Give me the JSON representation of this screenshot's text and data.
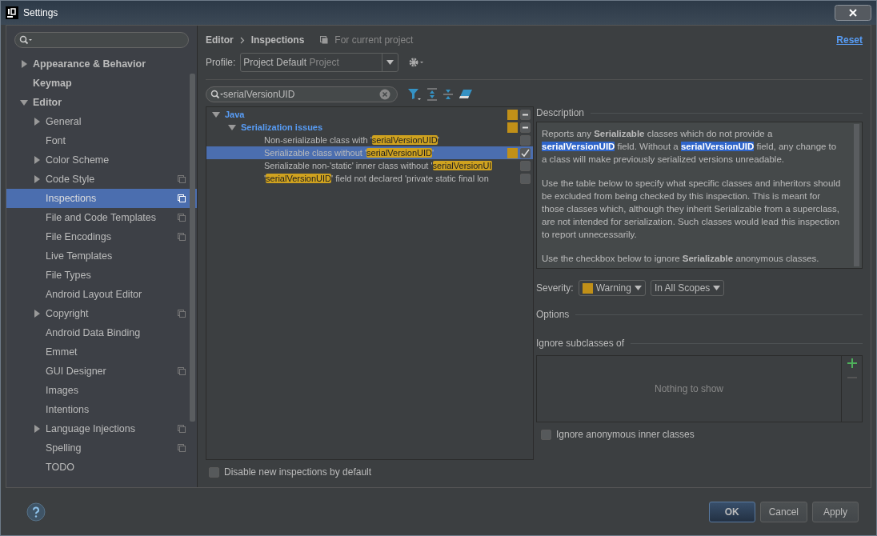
{
  "window": {
    "title": "Settings"
  },
  "sidebar": {
    "items": [
      {
        "label": "Appearance & Behavior",
        "expanded": false,
        "project_scope": false
      },
      {
        "label": "Keymap",
        "project_scope": false
      },
      {
        "label": "Editor",
        "expanded": true,
        "project_scope": false,
        "children": [
          {
            "label": "General",
            "expanded": false,
            "project_scope": false,
            "selected": false
          },
          {
            "label": "Font",
            "project_scope": false,
            "selected": false
          },
          {
            "label": "Color Scheme",
            "expanded": false,
            "project_scope": false,
            "selected": false
          },
          {
            "label": "Code Style",
            "expanded": false,
            "project_scope": true,
            "selected": false
          },
          {
            "label": "Inspections",
            "project_scope": true,
            "selected": true
          },
          {
            "label": "File and Code Templates",
            "project_scope": true,
            "selected": false
          },
          {
            "label": "File Encodings",
            "project_scope": true,
            "selected": false
          },
          {
            "label": "Live Templates",
            "project_scope": false,
            "selected": false
          },
          {
            "label": "File Types",
            "project_scope": false,
            "selected": false
          },
          {
            "label": "Android Layout Editor",
            "project_scope": false,
            "selected": false
          },
          {
            "label": "Copyright",
            "expanded": false,
            "project_scope": true,
            "selected": false
          },
          {
            "label": "Android Data Binding",
            "project_scope": false,
            "selected": false
          },
          {
            "label": "Emmet",
            "project_scope": false,
            "selected": false
          },
          {
            "label": "GUI Designer",
            "project_scope": true,
            "selected": false
          },
          {
            "label": "Images",
            "project_scope": false,
            "selected": false
          },
          {
            "label": "Intentions",
            "project_scope": false,
            "selected": false
          },
          {
            "label": "Language Injections",
            "expanded": false,
            "project_scope": true,
            "selected": false
          },
          {
            "label": "Spelling",
            "project_scope": true,
            "selected": false
          },
          {
            "label": "TODO",
            "project_scope": false,
            "selected": false
          }
        ]
      }
    ]
  },
  "breadcrumb": [
    "Editor",
    "Inspections"
  ],
  "scope_note": "For current project",
  "reset": "Reset",
  "profile": {
    "label": "Profile:",
    "value": "Project Default",
    "hint": "Project"
  },
  "filter": {
    "value": "serialVersionUID"
  },
  "tree": [
    {
      "label": "Java",
      "expanded": true,
      "severity_mark": true,
      "partial": true,
      "children": [
        {
          "label": "Serialization issues",
          "expanded": true,
          "severity_mark": true,
          "partial": true,
          "children": [
            {
              "parts": [
                {
                  "text": "Non-serializable class with '",
                  "match": false
                },
                {
                  "text": "serialVersionUID",
                  "match": true
                },
                {
                  "text": "'",
                  "match": false
                }
              ],
              "severity_mark": false,
              "checked": false,
              "selected": false
            },
            {
              "parts": [
                {
                  "text": "Serializable class without '",
                  "match": false
                },
                {
                  "text": "serialVersionUID",
                  "match": true
                },
                {
                  "text": "'",
                  "match": false
                }
              ],
              "severity_mark": true,
              "checked": true,
              "selected": true
            },
            {
              "parts": [
                {
                  "text": "Serializable non-'static' inner class without '",
                  "match": false
                },
                {
                  "text": "serialVersionUI",
                  "match": true
                }
              ],
              "severity_mark": false,
              "checked": false,
              "selected": false
            },
            {
              "parts": [
                {
                  "text": "'",
                  "match": false
                },
                {
                  "text": "serialVersionUID",
                  "match": true
                },
                {
                  "text": "' field not declared 'private static final lon",
                  "match": false
                }
              ],
              "severity_mark": false,
              "checked": false,
              "selected": false
            }
          ]
        }
      ]
    }
  ],
  "disable_new": {
    "label": "Disable new inspections by default",
    "checked": false
  },
  "description": {
    "title": "Description",
    "paragraphs": [
      [
        {
          "text": "Reports any ",
          "kind": "plain"
        },
        {
          "text": "Serializable",
          "kind": "bold"
        },
        {
          "text": " classes which do not provide a ",
          "kind": "plain"
        },
        {
          "text": "serialVersionUID",
          "kind": "selected"
        },
        {
          "text": " field. Without a ",
          "kind": "plain"
        },
        {
          "text": "serialVersionUID",
          "kind": "selected"
        },
        {
          "text": " field, any change to a class will make previously serialized versions unreadable.",
          "kind": "plain"
        }
      ],
      [
        {
          "text": "Use the table below to specify what specific classes and inheritors should be excluded from being checked by this inspection. This is meant for those classes which, although they inherit Serializable from a superclass, are not intended for serialization. Such classes would lead this inspection to report unnecessarily.",
          "kind": "plain"
        }
      ],
      [
        {
          "text": "Use the checkbox below to ignore ",
          "kind": "plain"
        },
        {
          "text": "Serializable",
          "kind": "bold"
        },
        {
          "text": " anonymous classes.",
          "kind": "plain"
        }
      ]
    ]
  },
  "severity": {
    "label": "Severity:",
    "value": "Warning",
    "scope": "In All Scopes"
  },
  "options_title": "Options",
  "ignore_subclasses": {
    "title": "Ignore subclasses of",
    "empty": "Nothing to show"
  },
  "ignore_anonymous": {
    "label": "Ignore anonymous inner classes",
    "checked": false
  },
  "buttons": [
    {
      "label": "OK",
      "kind": "primary"
    },
    {
      "label": "Cancel",
      "kind": "normal"
    },
    {
      "label": "Apply",
      "kind": "normal"
    }
  ]
}
